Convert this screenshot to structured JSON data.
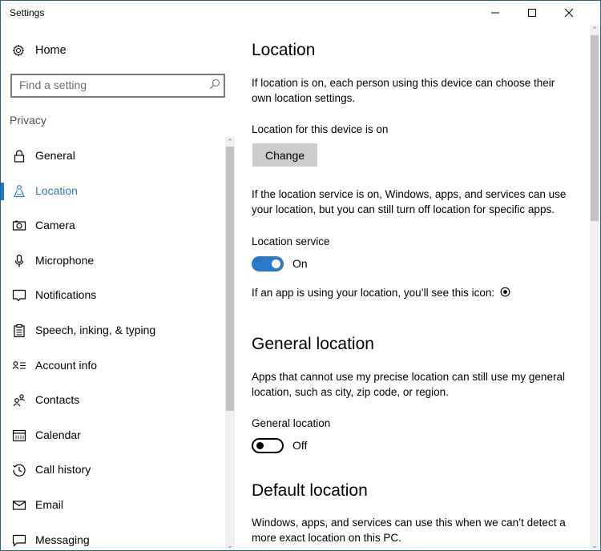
{
  "window": {
    "title": "Settings",
    "minimize_label": "Minimize",
    "maximize_label": "Maximize",
    "close_label": "Close"
  },
  "sidebar": {
    "home_label": "Home",
    "search_placeholder": "Find a setting",
    "section_label": "Privacy",
    "active_item": "Location",
    "accent_color": "#1b79c9",
    "items": [
      {
        "label": "General",
        "icon": "lock-icon"
      },
      {
        "label": "Location",
        "icon": "location-person-icon"
      },
      {
        "label": "Camera",
        "icon": "camera-icon"
      },
      {
        "label": "Microphone",
        "icon": "microphone-icon"
      },
      {
        "label": "Notifications",
        "icon": "speech-bubble-icon"
      },
      {
        "label": "Speech, inking, & typing",
        "icon": "clipboard-icon"
      },
      {
        "label": "Account info",
        "icon": "contact-card-icon"
      },
      {
        "label": "Contacts",
        "icon": "people-icon"
      },
      {
        "label": "Calendar",
        "icon": "calendar-icon"
      },
      {
        "label": "Call history",
        "icon": "history-icon"
      },
      {
        "label": "Email",
        "icon": "mail-icon"
      },
      {
        "label": "Messaging",
        "icon": "message-icon"
      }
    ]
  },
  "main": {
    "title": "Location",
    "intro": "If location is on, each person using this device can choose their own location settings.",
    "device_status": "Location for this device is on",
    "change_button": "Change",
    "service_desc": "If the location service is on, Windows, apps, and services can use your location, but you can still turn off location for specific apps.",
    "service_label": "Location service",
    "service_state": "On",
    "service_on": true,
    "icon_note": "If an app is using your location, you’ll see this icon:",
    "general_title": "General location",
    "general_desc": "Apps that cannot use my precise location can still use my general location, such as city, zip code, or region.",
    "general_label": "General location",
    "general_state": "Off",
    "general_on": false,
    "default_title": "Default location",
    "default_desc": "Windows, apps, and services can use this when we can’t detect a more exact location on this PC.",
    "toggle_on_color": "#2a78c8"
  }
}
